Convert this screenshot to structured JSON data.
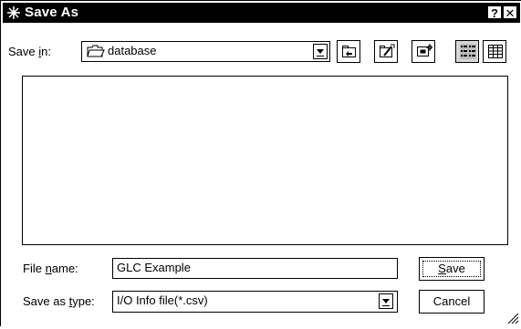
{
  "window": {
    "title": "Save As",
    "help_label": "?",
    "close_label": "✕"
  },
  "save_in": {
    "label_pre": "Save ",
    "label_mnemonic": "i",
    "label_post": "n:",
    "value": "database",
    "folder_icon": "open-folder-icon"
  },
  "toolbar": {
    "buttons": [
      {
        "name": "up-one-level",
        "icon": "folder-up-icon"
      },
      {
        "name": "create-new-folder",
        "icon": "new-folder-icon"
      },
      {
        "name": "desktop",
        "icon": "desktop-icon"
      },
      {
        "name": "list-view",
        "icon": "list-view-icon"
      },
      {
        "name": "details-view",
        "icon": "details-view-icon"
      }
    ]
  },
  "file_list": {
    "items": []
  },
  "file_name": {
    "label_pre": "File ",
    "label_mnemonic": "n",
    "label_post": "ame:",
    "value": "GLC Example"
  },
  "save_as_type": {
    "label_pre": "Save as ",
    "label_mnemonic": "t",
    "label_post": "ype:",
    "value": "I/O Info file(*.csv)"
  },
  "buttons": {
    "save_mnemonic": "S",
    "save_rest": "ave",
    "cancel_label": "Cancel"
  }
}
